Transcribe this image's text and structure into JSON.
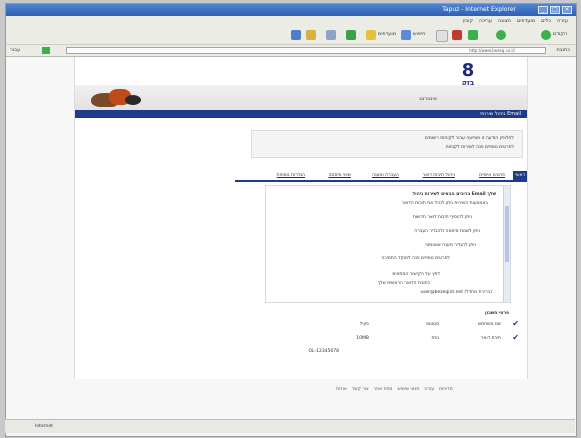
{
  "window": {
    "title": "Tapuz - Internet Explorer",
    "status_text": "Internet"
  },
  "menubar": {
    "items": [
      "קובץ",
      "עריכה",
      "תצוגה",
      "מועדפים",
      "כלים",
      "עזרה"
    ]
  },
  "toolbar": {
    "search_label": "חיפוש",
    "favorites_label": "מועדפים",
    "back_label": "הקודם"
  },
  "addressbar": {
    "label": "כתובת",
    "url": "http://www.bezeq.co.il/",
    "go_label": "עבור"
  },
  "site": {
    "logo_number": "8",
    "logo_word": "בזק",
    "banner_label": "אינטרנט",
    "bluebar_label": "ניהול שירותי Email",
    "message_lines": [
      "לחלופין הודעה זו מופיעה עבור לקוחות רשומים",
      "לפרטים נוספים פנה לשירות לקוחות"
    ],
    "tabs": [
      {
        "label": "ראשי",
        "active": true
      },
      {
        "label": "פרטים אישיים",
        "active": false
      },
      {
        "label": "ניהול תיבות דואר",
        "active": false
      },
      {
        "label": "העברה ומענה",
        "active": false
      },
      {
        "label": "שינוי סיסמה",
        "active": false
      },
      {
        "label": "הגדרות נוספות",
        "active": false
      }
    ],
    "main_lines": [
      "ברוכים הבאים לשירות ניהול Email שלך",
      "באמצעות השירות ניתן לנהל את תיבות הדואר",
      "ניתן להוסיף תיבות דואר חדשות",
      "ניתן לשנות סיסמה ולהגדיר העברה",
      "ניתן להגדיר מענה אוטומטי",
      "לפרטים נוספים פנה למוקד התמיכה",
      "לחץ על הקישור המתאים",
      "כתובת הדואר הראשית שלך",
      "user@bezeqint.net  (ברירת מחדל)"
    ],
    "table": {
      "header": "פרטי חשבון",
      "rows": [
        {
          "col1": "שם משתמש",
          "col2": "סטטוס",
          "col3": "פעיל"
        },
        {
          "col1": "תיבת דואר",
          "col2": "נפח",
          "col3": "10MB"
        }
      ],
      "footer": "OL-12345678"
    },
    "footer_links": [
      "אודות",
      "צור קשר",
      "מפת אתר",
      "תנאי שימוש",
      "עזרה",
      "מדיניות"
    ]
  }
}
